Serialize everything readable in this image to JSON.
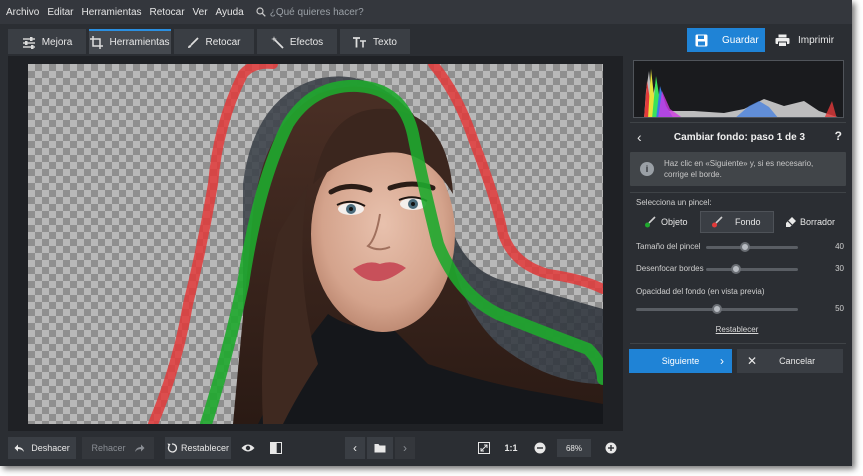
{
  "menu": {
    "items": [
      "Archivo",
      "Editar",
      "Herramientas",
      "Retocar",
      "Ver",
      "Ayuda"
    ],
    "search_placeholder": "¿Qué quieres hacer?"
  },
  "tabs": [
    {
      "label": "Mejora",
      "icon": "sliders-icon"
    },
    {
      "label": "Herramientas",
      "icon": "crop-icon",
      "active": true
    },
    {
      "label": "Retocar",
      "icon": "brush-icon"
    },
    {
      "label": "Efectos",
      "icon": "magic-wand-icon"
    },
    {
      "label": "Texto",
      "icon": "text-icon"
    }
  ],
  "toolbar": {
    "save_label": "Guardar",
    "print_label": "Imprimir"
  },
  "panel": {
    "step_title": "Cambiar fondo: paso 1 de 3",
    "help": "?",
    "info_line1": "Haz clic en «Siguiente» y, si es necesario,",
    "info_line2": "corrige el borde.",
    "brush_label": "Selecciona un pincel:",
    "brushes": {
      "objeto": "Objeto",
      "fondo": "Fondo",
      "borrador": "Borrador"
    },
    "sliders": {
      "size_label": "Tamaño del pincel",
      "size_value": "40",
      "size_fraction": 0.42,
      "blur_label": "Desenfocar bordes",
      "blur_value": "30",
      "blur_fraction": 0.33,
      "opacity_label": "Opacidad del fondo (en vista previa)",
      "opacity_value": "50",
      "opacity_fraction": 0.5
    },
    "reset_link": "Restablecer",
    "next_label": "Siguiente",
    "cancel_label": "Cancelar"
  },
  "bottom": {
    "undo": "Deshacer",
    "redo": "Rehacer",
    "reset": "Restablecer",
    "ratio": "1:1",
    "zoom": "68%"
  },
  "colors": {
    "accent": "#1f83d6",
    "object_stroke": "#1fa82e",
    "background_stroke": "#e23a3a"
  }
}
